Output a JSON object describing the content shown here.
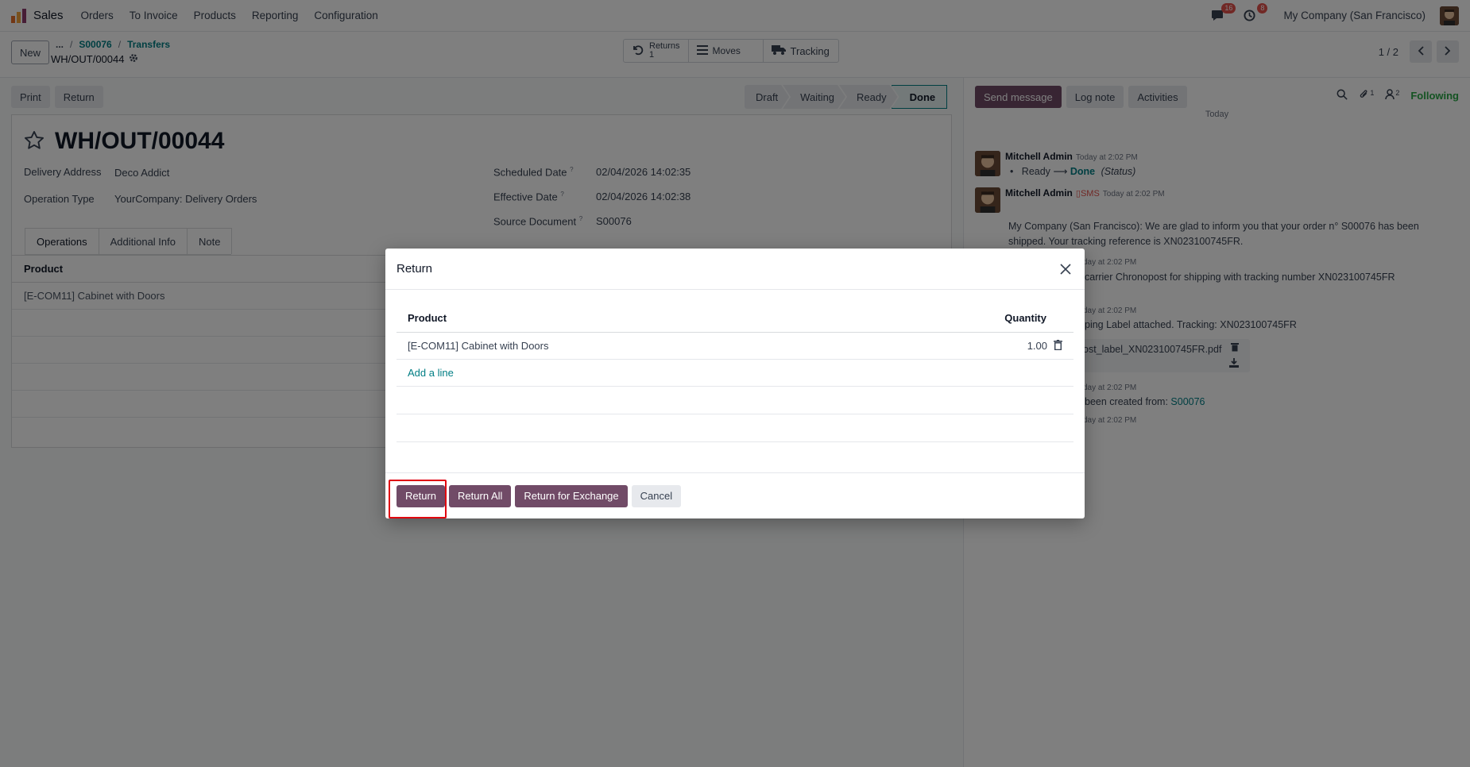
{
  "navbar": {
    "app_name": "Sales",
    "menu": [
      "Orders",
      "To Invoice",
      "Products",
      "Reporting",
      "Configuration"
    ],
    "messages_count": "16",
    "activities_count": "8",
    "company": "My Company (San Francisco)"
  },
  "control": {
    "new_label": "New",
    "breadcrumb_ellipsis": "...",
    "breadcrumb": [
      "S00076",
      "Transfers"
    ],
    "record_name": "WH/OUT/00044",
    "smart_buttons": {
      "returns_label": "Returns",
      "returns_count": "1",
      "moves_label": "Moves",
      "tracking_label": "Tracking"
    },
    "pager": "1 / 2"
  },
  "form": {
    "print_label": "Print",
    "return_label": "Return",
    "status_steps": [
      "Draft",
      "Waiting",
      "Ready",
      "Done"
    ],
    "active_status": "Done",
    "title": "WH/OUT/00044",
    "delivery_address_label": "Delivery Address",
    "delivery_address": "Deco Addict",
    "operation_type_label": "Operation Type",
    "operation_type": "YourCompany: Delivery Orders",
    "scheduled_date_label": "Scheduled Date",
    "scheduled_date": "02/04/2026 14:02:35",
    "effective_date_label": "Effective Date",
    "effective_date": "02/04/2026 14:02:38",
    "source_document_label": "Source Document",
    "source_document": "S00076",
    "help_mark": "?",
    "tabs": [
      "Operations",
      "Additional Info",
      "Note"
    ],
    "product_header": "Product",
    "product_row": "[E-COM11] Cabinet with Doors"
  },
  "chatter": {
    "send_message": "Send message",
    "log_note": "Log note",
    "activities": "Activities",
    "attachments_count": "1",
    "followers_count": "2",
    "following": "Following",
    "today": "Today",
    "msg1_author": "Mitchell Admin",
    "msg1_time": "Today at 2:02 PM",
    "msg1_from": "Ready",
    "msg1_to": "Done",
    "msg1_field": "(Status)",
    "msg2_author": "Mitchell Admin",
    "msg2_sms": "SMS",
    "msg2_time": "Today at 2:02 PM",
    "msg2_text": "My Company (San Francisco): We are glad to inform you that your order n° S00076 has been shipped. Your tracking reference is XN023100745FR.",
    "msg3_time": "day at 2:02 PM",
    "msg3_text": "carrier Chronopost for shipping with tracking number XN023100745FR",
    "msg4_time": "day at 2:02 PM",
    "msg4_text": "ping Label attached. Tracking: XN023100745FR",
    "attachment_name": "ost_label_XN023100745FR.pdf",
    "msg5_time": "day at 2:02 PM",
    "msg5_text": "been created from:",
    "msg5_link": "S00076",
    "msg6_time": "day at 2:02 PM"
  },
  "dialog": {
    "title": "Return",
    "col_product": "Product",
    "col_quantity": "Quantity",
    "row_product": "[E-COM11] Cabinet with Doors",
    "row_quantity": "1.00",
    "add_line": "Add a line",
    "btn_return": "Return",
    "btn_return_all": "Return All",
    "btn_return_exchange": "Return for Exchange",
    "btn_cancel": "Cancel"
  },
  "colors": {
    "brand_primary": "#714b67",
    "link": "#017e84",
    "highlight": "#e0000f"
  }
}
